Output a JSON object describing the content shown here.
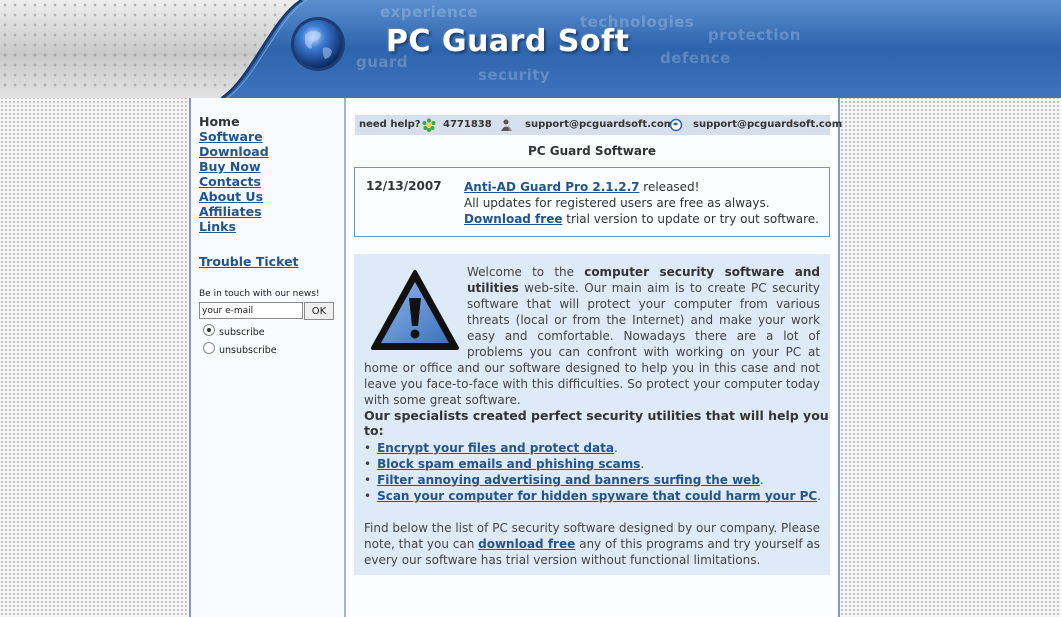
{
  "header": {
    "logo_title": "PC Guard Soft",
    "background_words": [
      "experience",
      "technologies",
      "protection",
      "guard",
      "security",
      "defence"
    ]
  },
  "nav": {
    "items": [
      {
        "label": "Home",
        "active": true
      },
      {
        "label": "Software"
      },
      {
        "label": "Download"
      },
      {
        "label": "Buy Now"
      },
      {
        "label": "Contacts"
      },
      {
        "label": "About Us"
      },
      {
        "label": "Affiliates"
      },
      {
        "label": "Links"
      }
    ],
    "trouble_ticket": "Trouble Ticket"
  },
  "newsletter": {
    "label": "Be in touch with our news!",
    "email_value": "your e-mail",
    "ok_label": "OK",
    "subscribe_label": "subscribe",
    "unsubscribe_label": "unsubscribe",
    "selected": "subscribe"
  },
  "helpbar": {
    "need_help": "need help?",
    "icq": "4771838",
    "email_1": "support@pcguardsoft.com",
    "email_2": "support@pcguardsoft.com"
  },
  "page_title": "PC Guard Software",
  "news": {
    "date": "12/13/2007",
    "product_link": "Anti-AD Guard Pro 2.1.2.7",
    "released": " released!",
    "line2": "All updates for registered users are free as always.",
    "download_link": "Download free",
    "line3_rest": " trial version to update or try out software."
  },
  "welcome": {
    "intro_1": "Welcome to the ",
    "intro_bold": "computer security software and utilities",
    "intro_2": " web-site. Our main aim is to create PC security software that will protect your computer from various threats (local or from the Internet) and make your work easy and comfortable. Nowadays there are a lot of problems you can confront with working on your PC at home or office and our software designed to help you in this case and not leave you face-to-face with this difficulties. So protect your computer today with some great software.",
    "specialists": "Our specialists created perfect security utilities that will help you to:",
    "features": [
      "Encrypt your files and protect data",
      "Block spam emails and phishing scams",
      "Filter annoying advertising and banners surfing the web",
      "Scan your computer for hidden spyware that could harm your PC"
    ],
    "find_1": "Find below the list of PC security software designed by our company. Please note, that you can ",
    "find_link": "download free",
    "find_2": " any of this programs and try yourself as every our software has trial version without functional limitations."
  },
  "colors": {
    "link": "#22558f",
    "header_blue": "#2f66ad",
    "welcome_bg": "#dfeaf8",
    "helpbar_bg": "#d6e0ec"
  }
}
